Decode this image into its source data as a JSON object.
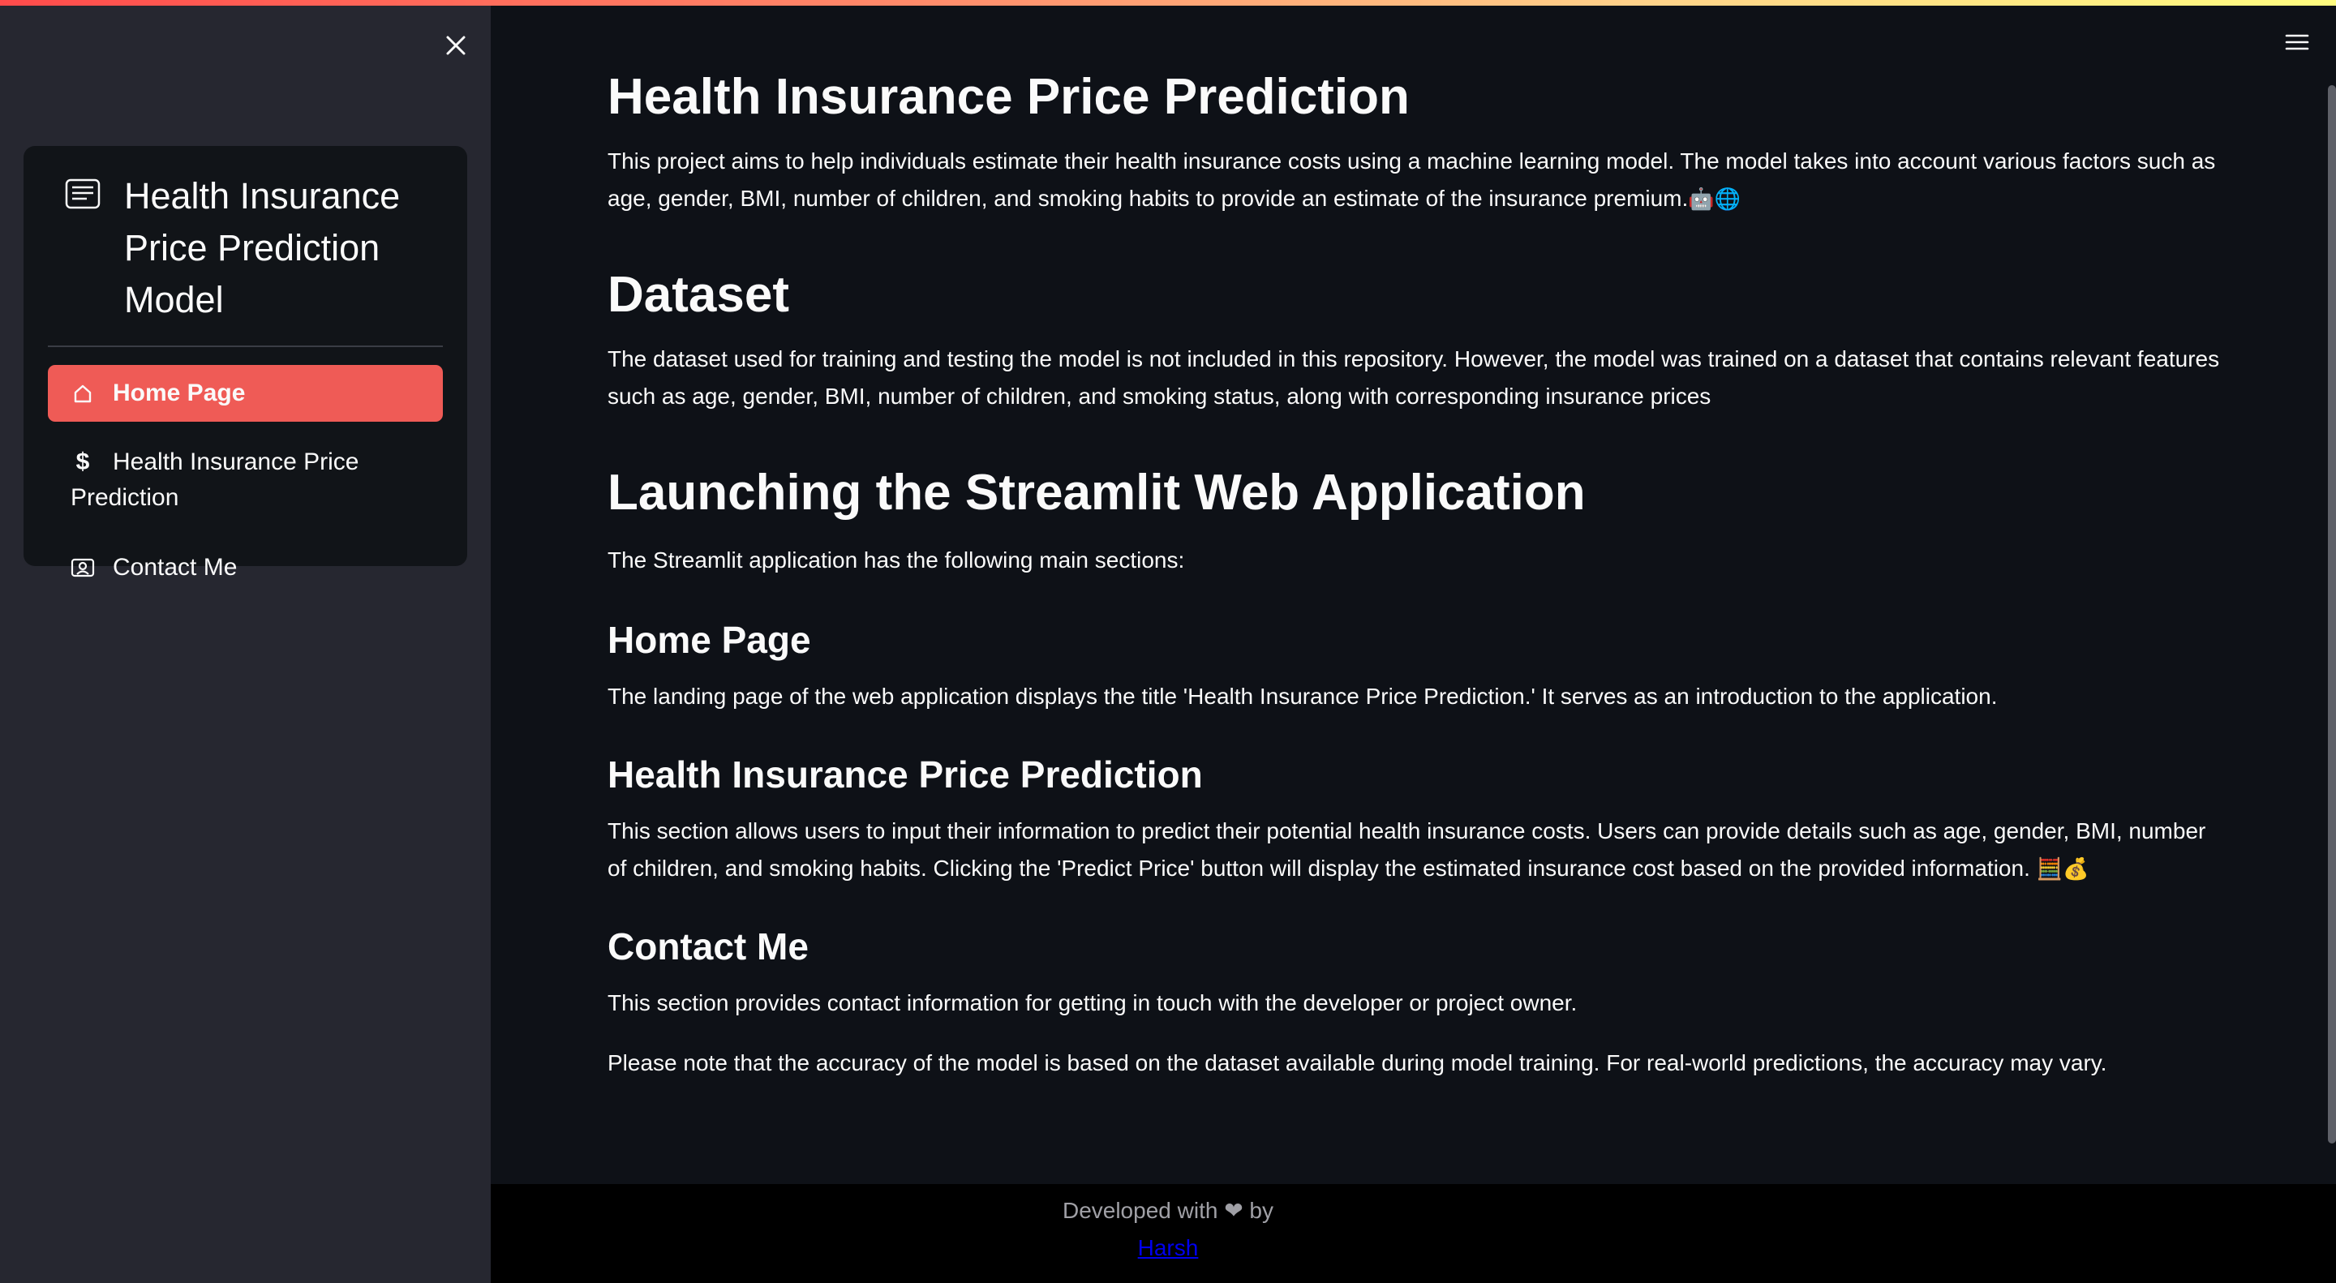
{
  "sidebar": {
    "menu_title": "Health Insurance Price Prediction Model",
    "items": [
      {
        "label": "Home Page",
        "icon": "house-icon",
        "active": true
      },
      {
        "label": "Health Insurance Price Prediction",
        "icon": "dollar-icon",
        "active": false
      },
      {
        "label": "Contact Me",
        "icon": "person-badge-icon",
        "active": false
      }
    ]
  },
  "main": {
    "title": "Health Insurance Price Prediction",
    "intro": "This project aims to help individuals estimate their health insurance costs using a machine learning model. The model takes into account various factors such as age, gender, BMI, number of children, and smoking habits to provide an estimate of the insurance premium.",
    "intro_emoji": "🤖🌐",
    "dataset_heading": "Dataset",
    "dataset_text": "The dataset used for training and testing the model is not included in this repository. However, the model was trained on a dataset that contains relevant features such as age, gender, BMI, number of children, and smoking status, along with corresponding insurance prices",
    "launch_heading": "Launching the Streamlit Web Application",
    "launch_text": "The Streamlit application has the following main sections:",
    "home_heading": "Home Page",
    "home_text": "The landing page of the web application displays the title 'Health Insurance Price Prediction.' It serves as an introduction to the application.",
    "prediction_heading": "Health Insurance Price Prediction",
    "prediction_text": "This section allows users to input their information to predict their potential health insurance costs. Users can provide details such as age, gender, BMI, number of children, and smoking habits. Clicking the 'Predict Price' button will display the estimated insurance cost based on the provided information.",
    "prediction_emoji": "🧮💰",
    "contact_heading": "Contact Me",
    "contact_text": "This section provides contact information for getting in touch with the developer or project owner.",
    "note_text": "Please note that the accuracy of the model is based on the dataset available during model training. For real-world predictions, the accuracy may vary."
  },
  "footer": {
    "text": "Developed with ❤ by",
    "link": "Harsh"
  },
  "colors": {
    "accent": "#ef5b56",
    "sidebar_bg": "#262730",
    "main_bg": "#0e1117",
    "menu_bg": "#111418",
    "footer_bg": "#000000",
    "link": "#0000ee"
  }
}
